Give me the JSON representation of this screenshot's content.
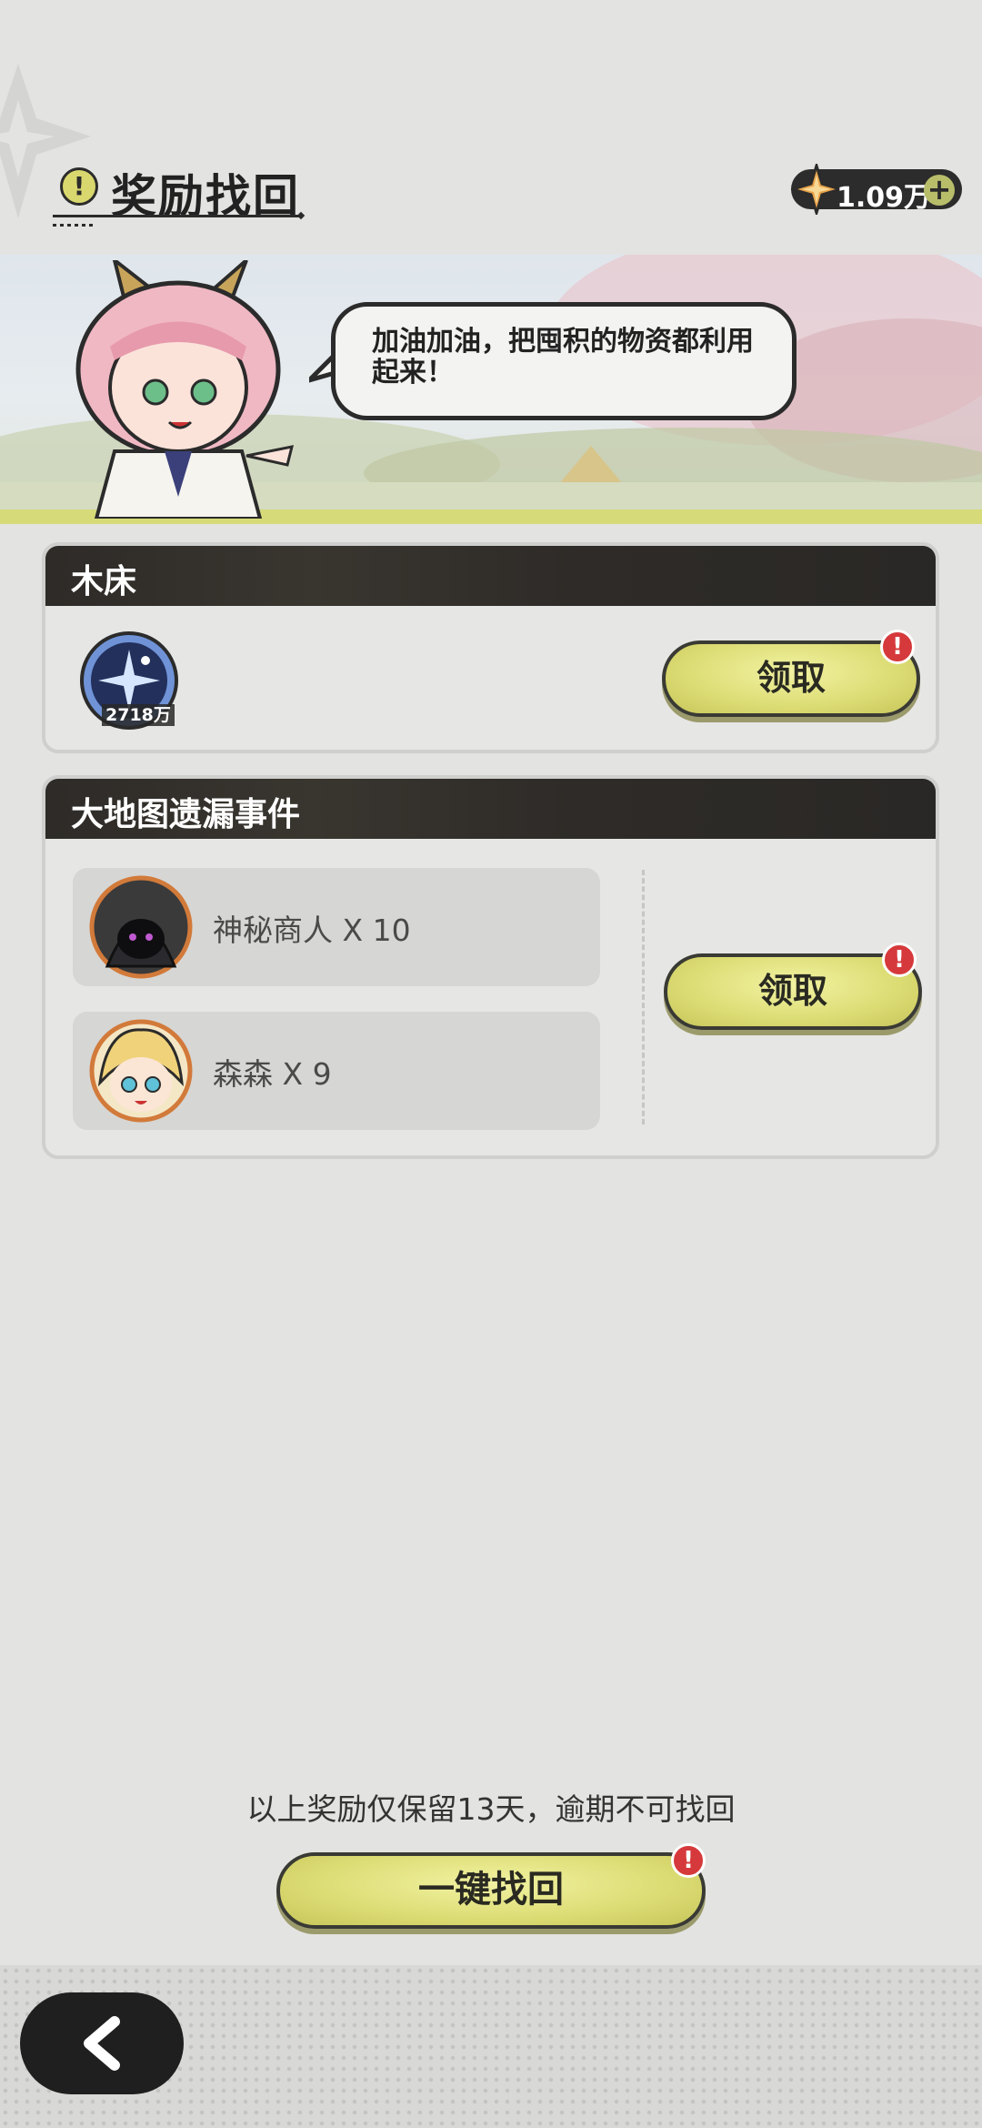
{
  "header": {
    "title": "奖励找回",
    "currency": {
      "value": "1.09万",
      "icon": "star-crystal-icon",
      "add_icon": "plus-icon"
    }
  },
  "banner": {
    "speech": "加油加油，把囤积的物资都利用起来！"
  },
  "sections": [
    {
      "title": "木床",
      "reward": {
        "icon": "blue-star-orb-icon",
        "count": "2718万"
      },
      "action_label": "领取"
    },
    {
      "title": "大地图遗漏事件",
      "events": [
        {
          "label": "神秘商人 X 10",
          "avatar": "hooded-merchant-avatar"
        },
        {
          "label": "森森 X 9",
          "avatar": "blonde-girl-avatar"
        }
      ],
      "action_label": "领取"
    }
  ],
  "footer": {
    "notice": "以上奖励仅保留13天，逾期不可找回",
    "retrieve_all_label": "一键找回"
  },
  "badge_symbol": "!",
  "colors": {
    "accent": "#dcdc74",
    "badge": "#d6393b",
    "header_dark": "#2e2b28"
  }
}
